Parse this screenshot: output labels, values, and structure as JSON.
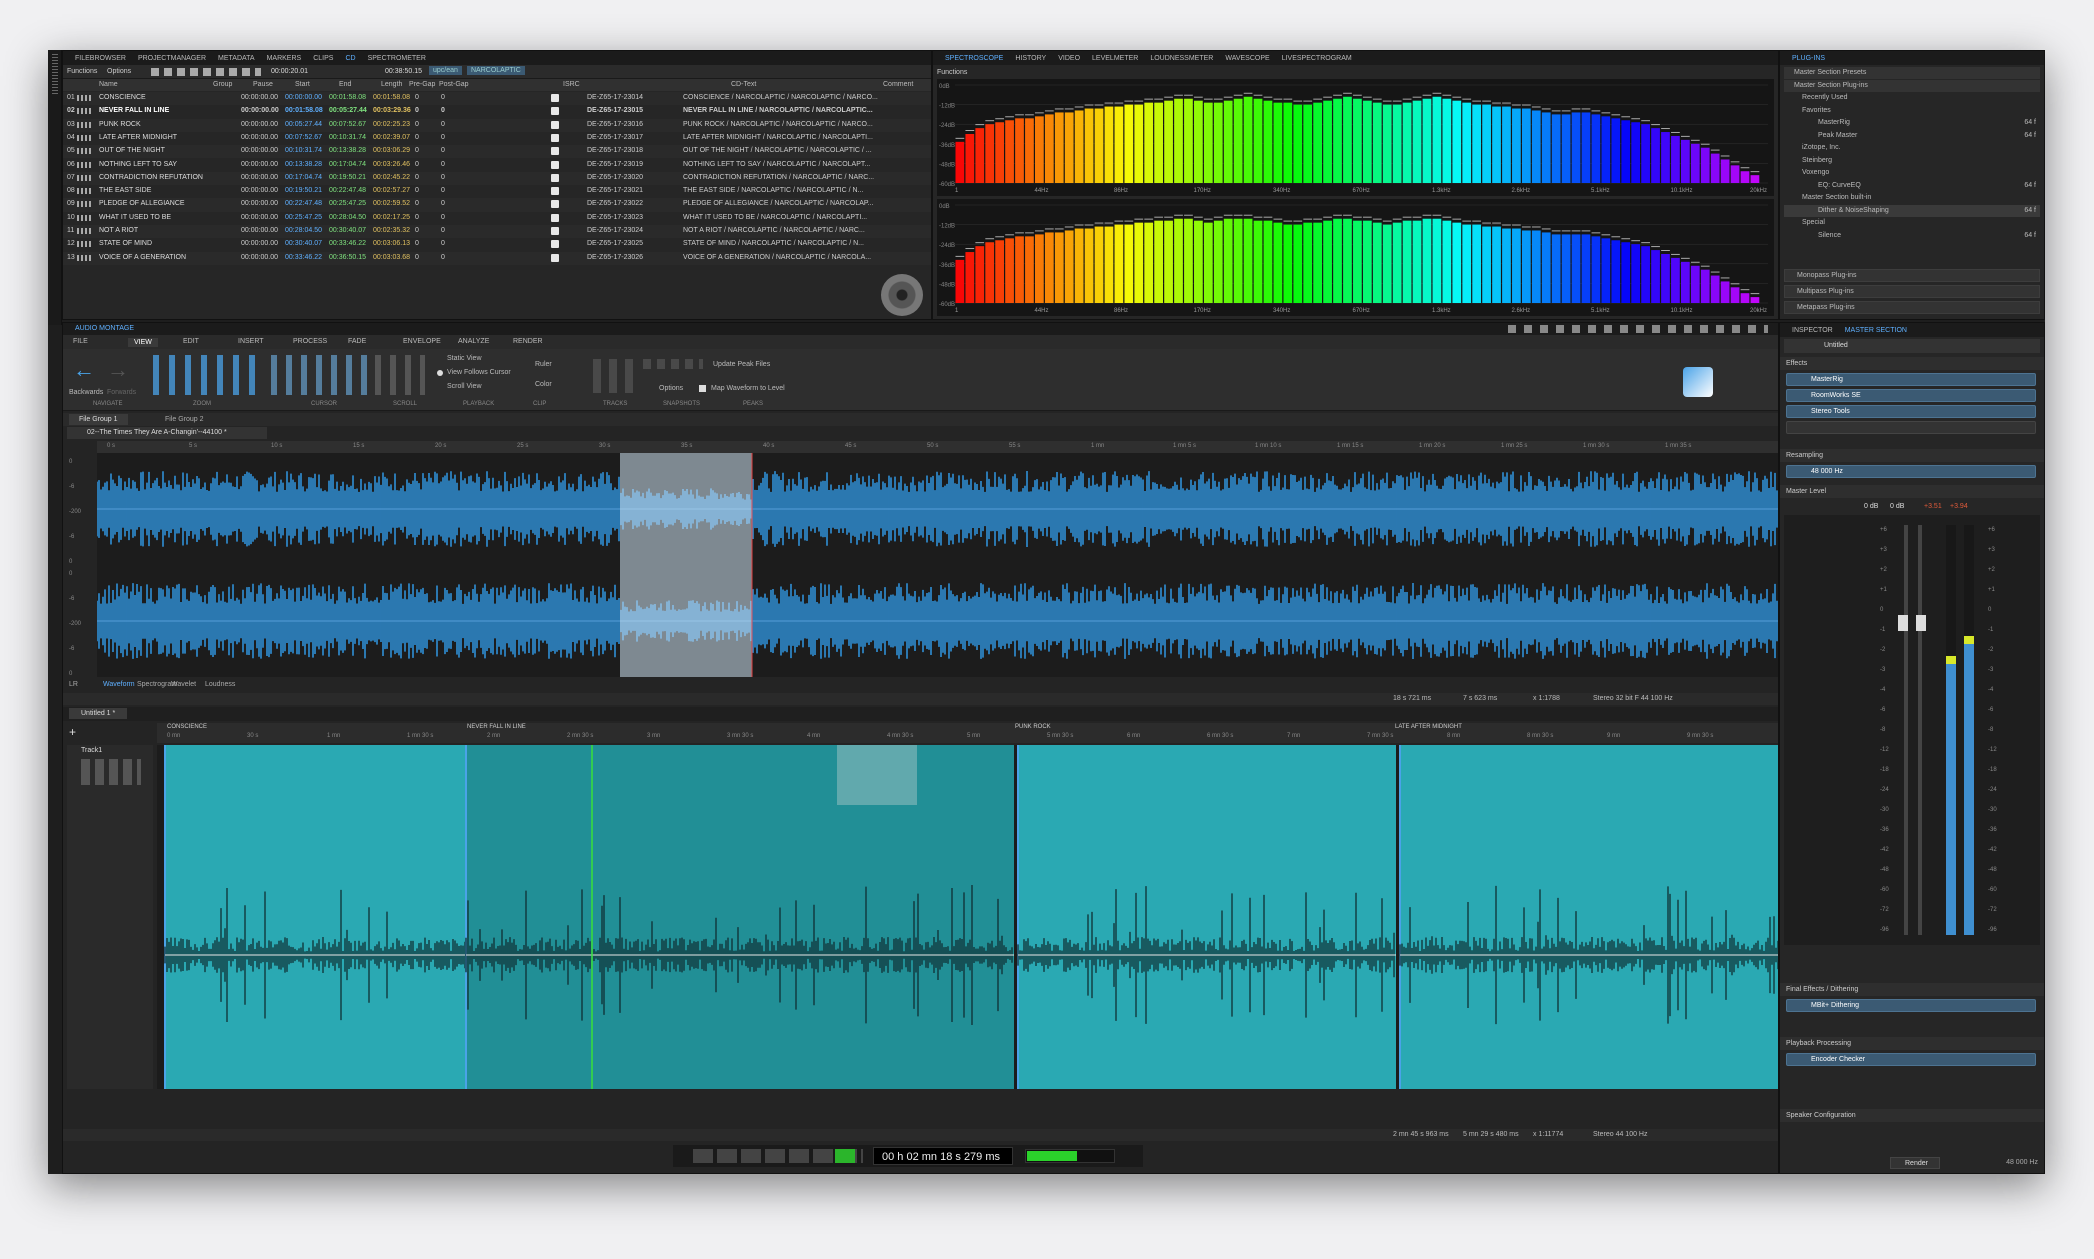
{
  "cd_panel": {
    "tabs": [
      "FILEBROWSER",
      "PROJECTMANAGER",
      "METADATA",
      "MARKERS",
      "CLIPS",
      "CD",
      "SPECTROMETER"
    ],
    "toolbar": {
      "functions": "Functions",
      "options": "Options",
      "time": "00:00:20.01",
      "total": "00:38:50.15",
      "badge1": "upc/ean",
      "badge2": "NARCOLAPTIC"
    },
    "headers": {
      "name": "Name",
      "group": "Group",
      "pause": "Pause",
      "start": "Start",
      "end": "End",
      "length": "Length",
      "pregap": "Pre-Gap",
      "postgap": "Post-Gap",
      "isrc": "ISRC",
      "cdtext": "CD-Text",
      "comment": "Comment"
    },
    "tracks": [
      {
        "num": "01",
        "name": "CONSCIENCE",
        "pause": "00:00:00.00",
        "start": "00:00:00.00",
        "end": "00:01:58.08",
        "length": "00:01:58.08",
        "pre": "0",
        "post": "0",
        "isrc": "DE-Z65-17-23014",
        "cdtext": "CONSCIENCE / NARCOLAPTIC / NARCOLAPTIC / NARCO..."
      },
      {
        "num": "02",
        "name": "NEVER FALL IN LINE",
        "pause": "00:00:00.00",
        "start": "00:01:58.08",
        "end": "00:05:27.44",
        "length": "00:03:29.36",
        "pre": "0",
        "post": "0",
        "isrc": "DE-Z65-17-23015",
        "cdtext": "NEVER FALL IN LINE / NARCOLAPTIC / NARCOLAPTIC..."
      },
      {
        "num": "03",
        "name": "PUNK ROCK",
        "pause": "00:00:00.00",
        "start": "00:05:27.44",
        "end": "00:07:52.67",
        "length": "00:02:25.23",
        "pre": "0",
        "post": "0",
        "isrc": "DE-Z65-17-23016",
        "cdtext": "PUNK ROCK / NARCOLAPTIC / NARCOLAPTIC / NARCO..."
      },
      {
        "num": "04",
        "name": "LATE AFTER MIDNIGHT",
        "pause": "00:00:00.00",
        "start": "00:07:52.67",
        "end": "00:10:31.74",
        "length": "00:02:39.07",
        "pre": "0",
        "post": "0",
        "isrc": "DE-Z65-17-23017",
        "cdtext": "LATE AFTER MIDNIGHT / NARCOLAPTIC / NARCOLAPTI..."
      },
      {
        "num": "05",
        "name": "OUT OF THE NIGHT",
        "pause": "00:00:00.00",
        "start": "00:10:31.74",
        "end": "00:13:38.28",
        "length": "00:03:06.29",
        "pre": "0",
        "post": "0",
        "isrc": "DE-Z65-17-23018",
        "cdtext": "OUT OF THE NIGHT / NARCOLAPTIC / NARCOLAPTIC / ..."
      },
      {
        "num": "06",
        "name": "NOTHING LEFT TO SAY",
        "pause": "00:00:00.00",
        "start": "00:13:38.28",
        "end": "00:17:04.74",
        "length": "00:03:26.46",
        "pre": "0",
        "post": "0",
        "isrc": "DE-Z65-17-23019",
        "cdtext": "NOTHING LEFT TO SAY / NARCOLAPTIC / NARCOLAPT..."
      },
      {
        "num": "07",
        "name": "CONTRADICTION REFUTATION",
        "pause": "00:00:00.00",
        "start": "00:17:04.74",
        "end": "00:19:50.21",
        "length": "00:02:45.22",
        "pre": "0",
        "post": "0",
        "isrc": "DE-Z65-17-23020",
        "cdtext": "CONTRADICTION REFUTATION / NARCOLAPTIC / NARC..."
      },
      {
        "num": "08",
        "name": "THE EAST SIDE",
        "pause": "00:00:00.00",
        "start": "00:19:50.21",
        "end": "00:22:47.48",
        "length": "00:02:57.27",
        "pre": "0",
        "post": "0",
        "isrc": "DE-Z65-17-23021",
        "cdtext": "THE EAST SIDE / NARCOLAPTIC / NARCOLAPTIC / N..."
      },
      {
        "num": "09",
        "name": "PLEDGE OF ALLEGIANCE",
        "pause": "00:00:00.00",
        "start": "00:22:47.48",
        "end": "00:25:47.25",
        "length": "00:02:59.52",
        "pre": "0",
        "post": "0",
        "isrc": "DE-Z65-17-23022",
        "cdtext": "PLEDGE OF ALLEGIANCE / NARCOLAPTIC / NARCOLAP..."
      },
      {
        "num": "10",
        "name": "WHAT IT USED TO BE",
        "pause": "00:00:00.00",
        "start": "00:25:47.25",
        "end": "00:28:04.50",
        "length": "00:02:17.25",
        "pre": "0",
        "post": "0",
        "isrc": "DE-Z65-17-23023",
        "cdtext": "WHAT IT USED TO BE / NARCOLAPTIC / NARCOLAPTI..."
      },
      {
        "num": "11",
        "name": "NOT A RIOT",
        "pause": "00:00:00.00",
        "start": "00:28:04.50",
        "end": "00:30:40.07",
        "length": "00:02:35.32",
        "pre": "0",
        "post": "0",
        "isrc": "DE-Z65-17-23024",
        "cdtext": "NOT A RIOT / NARCOLAPTIC / NARCOLAPTIC / NARC..."
      },
      {
        "num": "12",
        "name": "STATE OF MIND",
        "pause": "00:00:00.00",
        "start": "00:30:40.07",
        "end": "00:33:46.22",
        "length": "00:03:06.13",
        "pre": "0",
        "post": "0",
        "isrc": "DE-Z65-17-23025",
        "cdtext": "STATE OF MIND / NARCOLAPTIC / NARCOLAPTIC / N..."
      },
      {
        "num": "13",
        "name": "VOICE OF A GENERATION",
        "pause": "00:00:00.00",
        "start": "00:33:46.22",
        "end": "00:36:50.15",
        "length": "00:03:03.68",
        "pre": "0",
        "post": "0",
        "isrc": "DE-Z65-17-23026",
        "cdtext": "VOICE OF A GENERATION / NARCOLAPTIC / NARCOLA..."
      }
    ]
  },
  "spectro": {
    "tabs": [
      "SPECTROSCOPE",
      "HISTORY",
      "VIDEO",
      "LEVELMETER",
      "LOUDNESSMETER",
      "WAVESCOPE",
      "LIVESPECTROGRAM"
    ],
    "functions": "Functions",
    "db_labels": [
      "0dB",
      "-12dB",
      "-24dB",
      "-36dB",
      "-48dB",
      "-60dB"
    ],
    "freq_labels": [
      "1",
      "44Hz",
      "86Hz",
      "170Hz",
      "340Hz",
      "670Hz",
      "1.3kHz",
      "2.6kHz",
      "5.1kHz",
      "10.1kHz",
      "20kHz"
    ],
    "bars_top": [
      0.42,
      0.5,
      0.56,
      0.6,
      0.62,
      0.64,
      0.66,
      0.66,
      0.68,
      0.7,
      0.72,
      0.72,
      0.74,
      0.76,
      0.76,
      0.78,
      0.78,
      0.8,
      0.8,
      0.82,
      0.82,
      0.84,
      0.86,
      0.86,
      0.84,
      0.82,
      0.82,
      0.84,
      0.86,
      0.88,
      0.86,
      0.84,
      0.82,
      0.82,
      0.8,
      0.8,
      0.82,
      0.84,
      0.86,
      0.88,
      0.86,
      0.84,
      0.82,
      0.8,
      0.8,
      0.82,
      0.84,
      0.86,
      0.88,
      0.86,
      0.84,
      0.82,
      0.8,
      0.8,
      0.78,
      0.78,
      0.76,
      0.76,
      0.74,
      0.72,
      0.7,
      0.7,
      0.72,
      0.72,
      0.7,
      0.68,
      0.66,
      0.64,
      0.62,
      0.6,
      0.56,
      0.52,
      0.48,
      0.44,
      0.4,
      0.36,
      0.3,
      0.24,
      0.18,
      0.12,
      0.08
    ],
    "bars_bottom": [
      0.44,
      0.52,
      0.58,
      0.62,
      0.64,
      0.66,
      0.68,
      0.68,
      0.7,
      0.72,
      0.72,
      0.74,
      0.76,
      0.76,
      0.78,
      0.78,
      0.8,
      0.8,
      0.82,
      0.82,
      0.84,
      0.84,
      0.86,
      0.86,
      0.84,
      0.82,
      0.84,
      0.86,
      0.86,
      0.86,
      0.84,
      0.84,
      0.82,
      0.8,
      0.8,
      0.82,
      0.82,
      0.84,
      0.86,
      0.86,
      0.84,
      0.84,
      0.82,
      0.8,
      0.82,
      0.84,
      0.84,
      0.86,
      0.86,
      0.84,
      0.82,
      0.8,
      0.8,
      0.78,
      0.78,
      0.76,
      0.76,
      0.74,
      0.74,
      0.72,
      0.7,
      0.7,
      0.7,
      0.7,
      0.68,
      0.66,
      0.64,
      0.62,
      0.6,
      0.58,
      0.54,
      0.5,
      0.46,
      0.42,
      0.38,
      0.34,
      0.28,
      0.22,
      0.16,
      0.1,
      0.06
    ]
  },
  "plugins": {
    "tab": "PLUG-INS",
    "items": [
      {
        "label": "Master Section Presets",
        "indent": 0,
        "right": ""
      },
      {
        "label": "Master Section Plug-ins",
        "indent": 0,
        "right": ""
      },
      {
        "label": "Recently Used",
        "indent": 1,
        "right": ""
      },
      {
        "label": "Favorites",
        "indent": 1,
        "right": ""
      },
      {
        "label": "MasterRig",
        "indent": 3,
        "right": "64 f"
      },
      {
        "label": "Peak Master",
        "indent": 3,
        "right": "64 f"
      },
      {
        "label": "iZotope, Inc.",
        "indent": 1,
        "right": ""
      },
      {
        "label": "Steinberg",
        "indent": 1,
        "right": ""
      },
      {
        "label": "Voxengo",
        "indent": 1,
        "right": ""
      },
      {
        "label": "EQ: CurveEQ",
        "indent": 3,
        "right": "64 f"
      },
      {
        "label": "Master Section built-in",
        "indent": 1,
        "right": ""
      },
      {
        "label": "Dither & NoiseShaping",
        "indent": 3,
        "right": "64 f"
      },
      {
        "label": "Special",
        "indent": 1,
        "right": ""
      },
      {
        "label": "Silence",
        "indent": 3,
        "right": "64 f"
      }
    ],
    "footer": [
      "Monopass Plug-ins",
      "Multipass Plug-ins",
      "Metapass Plug-ins"
    ]
  },
  "audiomontage": {
    "title": "AUDIO MONTAGE",
    "ribbon_tabs": [
      "FILE",
      "VIEW",
      "EDIT",
      "INSERT",
      "PROCESS",
      "FADE",
      "ENVELOPE",
      "ANALYZE",
      "RENDER"
    ],
    "nav": {
      "back": "Backwards",
      "fwd": "Forwards"
    },
    "group_labels": [
      "NAVIGATE",
      "ZOOM",
      "CURSOR",
      "SCROLL",
      "PLAYBACK",
      "CLIP",
      "TRACKS",
      "SNAPSHOTS",
      "PEAKS"
    ],
    "playback_opts": [
      "Static View",
      "View Follows Cursor",
      "Scroll View"
    ],
    "clip_opts": [
      "Ruler",
      "Color"
    ],
    "options": "Options",
    "peaks": {
      "update": "Update Peak Files",
      "map": "Map Waveform to Level"
    }
  },
  "wave": {
    "file_groups": [
      "File Group 1",
      "File Group 2"
    ],
    "file_tab": "02--The Times They Are A-Changin'--44100 *",
    "ruler": [
      "0 s",
      "5 s",
      "10 s",
      "15 s",
      "20 s",
      "25 s",
      "30 s",
      "35 s",
      "40 s",
      "45 s",
      "50 s",
      "55 s",
      "1 mn",
      "1 mn 5 s",
      "1 mn 10 s",
      "1 mn 15 s",
      "1 mn 20 s",
      "1 mn 25 s",
      "1 mn 30 s",
      "1 mn 35 s"
    ],
    "db": [
      "0",
      "-6",
      "-200",
      "-6",
      "0"
    ],
    "bottom_tabs": [
      "LR",
      "Waveform",
      "Spectrogram",
      "Wavelet",
      "Loudness"
    ],
    "status": {
      "pos": "18 s 721 ms",
      "len": "7 s 623 ms",
      "zoom": "x 1:1788",
      "fmt": "Stereo 32 bit F 44 100 Hz"
    }
  },
  "montage": {
    "tab": "Untitled 1 *",
    "track": "Track1",
    "ruler": [
      "0 mn",
      "30 s",
      "1 mn",
      "1 mn 30 s",
      "2 mn",
      "2 mn 30 s",
      "3 mn",
      "3 mn 30 s",
      "4 mn",
      "4 mn 30 s",
      "5 mn",
      "5 mn 30 s",
      "6 mn",
      "6 mn 30 s",
      "7 mn",
      "7 mn 30 s",
      "8 mn",
      "8 mn 30 s",
      "9 mn",
      "9 mn 30 s"
    ],
    "markers": [
      "CONSCIENCE",
      "NEVER FALL IN LINE",
      "PUNK ROCK",
      "LATE AFTER MIDNIGHT"
    ],
    "status": {
      "pos": "2 mn 45 s 963 ms",
      "len": "5 mn 29 s 480 ms",
      "zoom": "x 1:11774",
      "fmt": "Stereo 44 100 Hz"
    }
  },
  "transport": {
    "time": "00 h 02 mn 18 s 279 ms"
  },
  "inspector": {
    "tabs": [
      "INSPECTOR",
      "MASTER SECTION"
    ],
    "preset": "Untitled",
    "effects_label": "Effects",
    "effects": [
      "MasterRig",
      "RoomWorks SE",
      "Stereo Tools"
    ],
    "resampling": "Resampling",
    "rate": "48 000 Hz",
    "master_level": "Master Level",
    "levels": [
      "0 dB",
      "0 dB",
      "+3.51",
      "+3.94"
    ],
    "scale": [
      "+6",
      "+3",
      "+2",
      "+1",
      "0",
      "-1",
      "-2",
      "-3",
      "-4",
      "-6",
      "-8",
      "-12",
      "-18",
      "-24",
      "-30",
      "-36",
      "-42",
      "-48",
      "-60",
      "-72",
      "-96"
    ],
    "level_l": 0.68,
    "level_r": 0.73,
    "final_effects": "Final Effects / Dithering",
    "final": [
      "MBit+ Dithering"
    ],
    "playback_processing": "Playback Processing",
    "pp": [
      "Encoder Checker"
    ],
    "speaker": "Speaker Configuration",
    "render": "Render",
    "rate_out": "48 000 Hz"
  }
}
